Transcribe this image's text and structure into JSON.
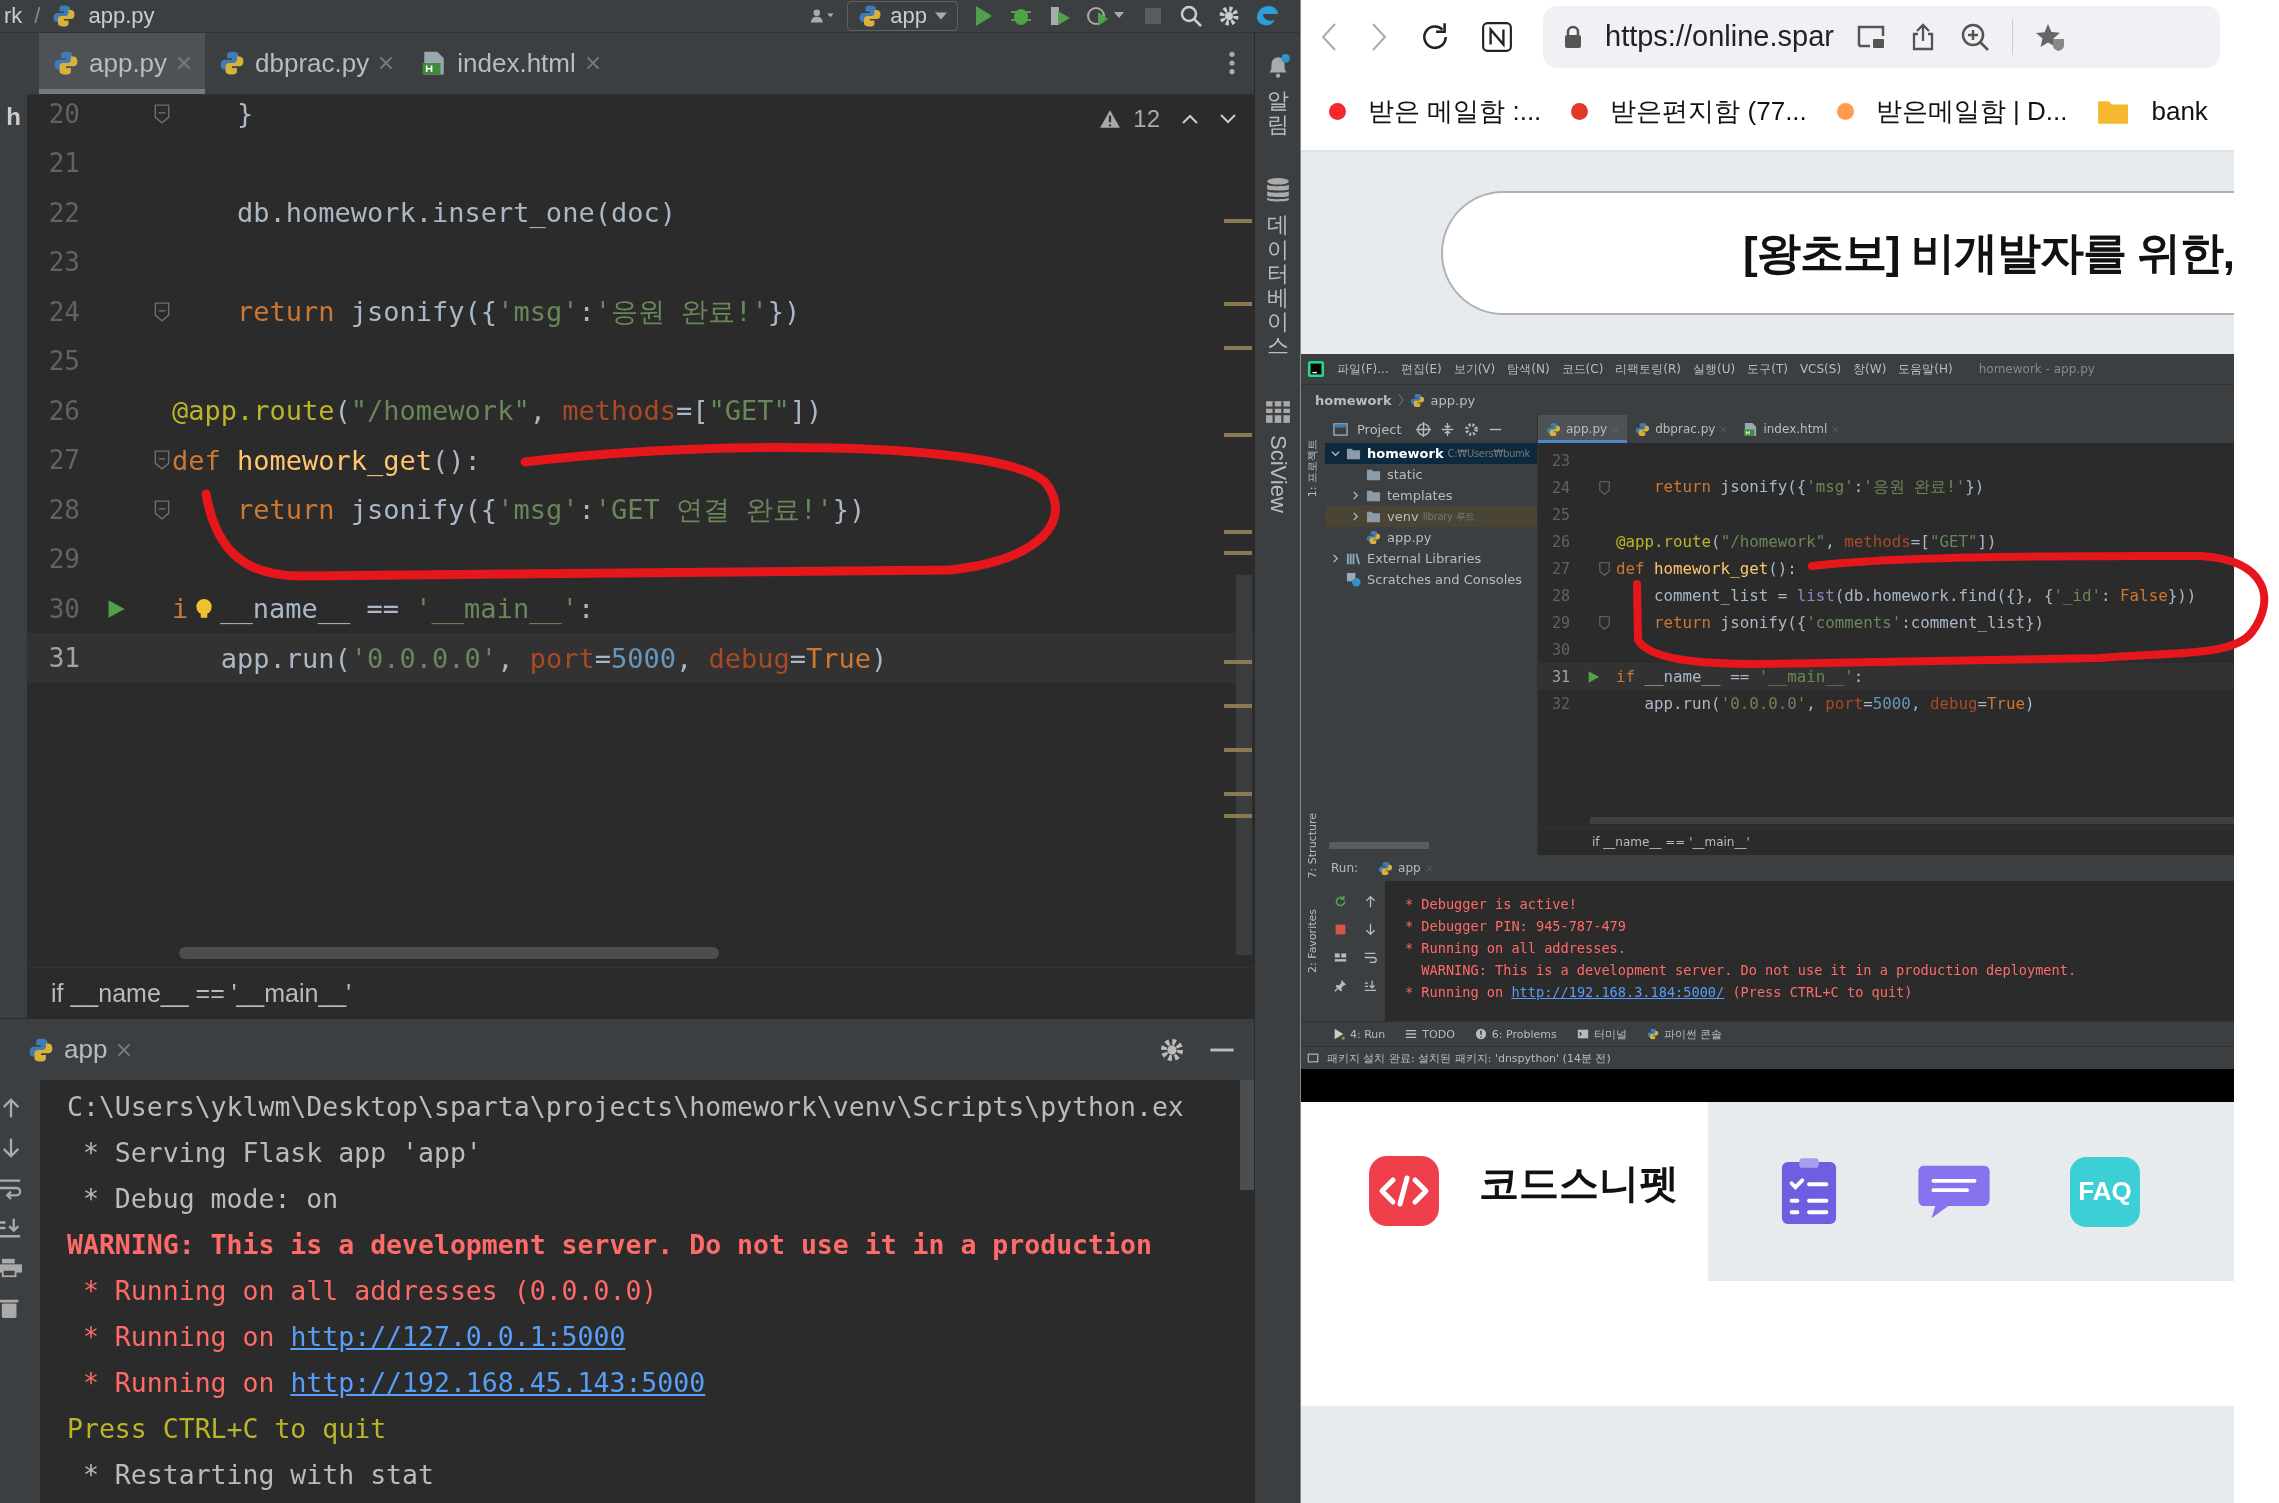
{
  "ide": {
    "toolbar": {
      "path": [
        {
          "kind": "text",
          "text": "rk"
        },
        {
          "kind": "sep",
          "text": "/"
        },
        {
          "kind": "file",
          "text": "app.py"
        }
      ],
      "run_config": "app"
    },
    "tabs": [
      {
        "label": "app.py",
        "kind": "python",
        "selected": true
      },
      {
        "label": "dbprac.py",
        "kind": "python",
        "selected": false
      },
      {
        "label": "index.html",
        "kind": "html",
        "selected": false
      }
    ],
    "left_strip_text": "h",
    "right_strip": [
      {
        "label": "알림",
        "kind": "bell"
      },
      {
        "label": "데이터베이스",
        "kind": "database"
      },
      {
        "label": "SciView",
        "kind": "grid"
      }
    ],
    "inspection": {
      "warnings": "12"
    },
    "code_lines": [
      {
        "number": "20",
        "kind": "fold",
        "current": false,
        "tokens": [
          {
            "kind": "plain",
            "text": "    }"
          }
        ]
      },
      {
        "number": "21",
        "kind": "plain",
        "current": false
      },
      {
        "number": "22",
        "kind": "plain",
        "current": false,
        "tokens": [
          {
            "kind": "plain",
            "text": "    db.homework.insert_one(doc)"
          }
        ]
      },
      {
        "number": "23",
        "kind": "plain",
        "current": false
      },
      {
        "number": "24",
        "kind": "fold",
        "current": false,
        "tokens": [
          {
            "kind": "keyword",
            "text": "    return"
          },
          {
            "kind": "plain",
            "text": " jsonify({"
          },
          {
            "kind": "string",
            "text": "'msg'"
          },
          {
            "kind": "plain",
            "text": ":"
          },
          {
            "kind": "string",
            "text": "'응원 완료!'"
          },
          {
            "kind": "plain",
            "text": "})"
          }
        ]
      },
      {
        "number": "25",
        "kind": "plain",
        "current": false
      },
      {
        "number": "26",
        "kind": "plain",
        "current": false,
        "tokens": [
          {
            "kind": "decorator",
            "text": "@app.route"
          },
          {
            "kind": "plain",
            "text": "("
          },
          {
            "kind": "string",
            "text": "\"/homework\""
          },
          {
            "kind": "plain",
            "text": ", "
          },
          {
            "kind": "param",
            "text": "methods"
          },
          {
            "kind": "plain",
            "text": "=["
          },
          {
            "kind": "string",
            "text": "\"GET\""
          },
          {
            "kind": "plain",
            "text": "])"
          }
        ]
      },
      {
        "number": "27",
        "kind": "fold",
        "current": false,
        "tokens": [
          {
            "kind": "keyword",
            "text": "def "
          },
          {
            "kind": "func",
            "text": "homework_get"
          },
          {
            "kind": "plain",
            "text": "():"
          }
        ]
      },
      {
        "number": "28",
        "kind": "fold",
        "current": false,
        "tokens": [
          {
            "kind": "keyword",
            "text": "    return"
          },
          {
            "kind": "plain",
            "text": " jsonify({"
          },
          {
            "kind": "string",
            "text": "'msg'"
          },
          {
            "kind": "plain",
            "text": ":"
          },
          {
            "kind": "string",
            "text": "'GET 연결 완료!'"
          },
          {
            "kind": "plain",
            "text": "})"
          }
        ]
      },
      {
        "number": "29",
        "kind": "plain",
        "current": false
      },
      {
        "number": "30",
        "kind": "run",
        "current": false,
        "tokens": [
          {
            "kind": "keyword",
            "text": "i"
          },
          {
            "kind": "bulb"
          },
          {
            "kind": "plain",
            "text": "__name__ == "
          },
          {
            "kind": "string",
            "text": "'__main__'"
          },
          {
            "kind": "plain",
            "text": ":"
          }
        ]
      },
      {
        "number": "31",
        "kind": "plain",
        "current": true,
        "tokens": [
          {
            "kind": "plain",
            "text": "   app.run("
          },
          {
            "kind": "string",
            "text": "'0.0.0.0'"
          },
          {
            "kind": "plain",
            "text": ", "
          },
          {
            "kind": "param",
            "text": "port"
          },
          {
            "kind": "plain",
            "text": "="
          },
          {
            "kind": "number",
            "text": "5000"
          },
          {
            "kind": "plain",
            "text": ", "
          },
          {
            "kind": "param",
            "text": "debug"
          },
          {
            "kind": "plain",
            "text": "="
          },
          {
            "kind": "keyword",
            "text": "True"
          },
          {
            "kind": "plain",
            "text": ")"
          }
        ]
      }
    ],
    "breadcrumb": "if __name__ == '__main__'",
    "run_tab": "app",
    "console": [
      {
        "kind": "plain",
        "text": "C:\\Users\\yklwm\\Desktop\\sparta\\projects\\homework\\venv\\Scripts\\python.ex"
      },
      {
        "kind": "plain",
        "text": " * Serving Flask app 'app'"
      },
      {
        "kind": "plain",
        "text": " * Debug mode: on"
      },
      {
        "kind": "warning",
        "text": "WARNING: This is a development server. Do not use it in a production"
      },
      {
        "kind": "error",
        "text": " * Running on all addresses (0.0.0.0)"
      },
      {
        "kind": "link",
        "text": " * Running on ",
        "url": "http://127.0.0.1:5000"
      },
      {
        "kind": "link",
        "text": " * Running on ",
        "url": "http://192.168.45.143:5000"
      },
      {
        "kind": "notice",
        "text": "Press CTRL+C to quit"
      },
      {
        "kind": "plain",
        "text": " * Restarting with stat"
      }
    ]
  },
  "browser": {
    "nav": {
      "back_enabled": false,
      "forward_enabled": false
    },
    "address": "https://online.spar",
    "bookmarks": [
      {
        "label": "받은 메일함 :...",
        "kind": "dot",
        "color": "#f5282a"
      },
      {
        "label": "받은편지함 (77...",
        "kind": "dot",
        "color": "#e0392b"
      },
      {
        "label": "받은메일함 | D...",
        "kind": "dot",
        "color": "#ff9a4f"
      },
      {
        "label": "bank",
        "kind": "folder"
      }
    ],
    "course_title": "[왕초보] 비개발자를 위한,",
    "video": {
      "menu": [
        "파일(F)...",
        "편집(E)",
        "보기(V)",
        "탐색(N)",
        "코드(C)",
        "리팩토링(R)",
        "실행(U)",
        "도구(T)",
        "VCS(S)",
        "창(W)",
        "도움말(H)"
      ],
      "title": "homework - app.py",
      "breadcrumb": [
        "homework",
        "app.py"
      ],
      "side_tabs": [
        {
          "label": "1: 프로젝트",
          "kind": "project"
        },
        {
          "label": "7: Structure",
          "kind": "structure"
        },
        {
          "label": "2: Favorites",
          "kind": "favorites"
        }
      ],
      "project_header": "Project",
      "tree": [
        {
          "label": "homework",
          "path": "C:₩Users₩bumk",
          "kind": "folder",
          "expanded": true,
          "selected": true,
          "excluded": false,
          "children": [
            {
              "label": "static",
              "kind": "folder",
              "selected": false,
              "excluded": false
            },
            {
              "label": "templates",
              "kind": "folder",
              "expanded": false,
              "selected": false,
              "excluded": false
            },
            {
              "label": "venv",
              "note": "library 루트",
              "kind": "folder",
              "expanded": false,
              "selected": false,
              "excluded": true
            },
            {
              "label": "app.py",
              "kind": "python",
              "selected": false,
              "excluded": false
            }
          ]
        },
        {
          "label": "External Libraries",
          "kind": "library",
          "expanded": false,
          "selected": false,
          "excluded": false
        },
        {
          "label": "Scratches and Consoles",
          "kind": "scratch",
          "selected": false,
          "excluded": false
        }
      ],
      "tabs": [
        {
          "label": "app.py",
          "kind": "python",
          "selected": true
        },
        {
          "label": "dbprac.py",
          "kind": "python",
          "selected": false
        },
        {
          "label": "index.html",
          "kind": "html",
          "selected": false
        }
      ],
      "code_lines": [
        {
          "number": "23",
          "kind": "plain",
          "current": false
        },
        {
          "number": "24",
          "kind": "fold",
          "current": false,
          "tokens": [
            {
              "kind": "keyword",
              "text": "    return"
            },
            {
              "kind": "plain",
              "text": " jsonify({"
            },
            {
              "kind": "string",
              "text": "'msg'"
            },
            {
              "kind": "plain",
              "text": ":"
            },
            {
              "kind": "string",
              "text": "'응원 완료!'"
            },
            {
              "kind": "plain",
              "text": "})"
            }
          ]
        },
        {
          "number": "25",
          "kind": "plain",
          "current": false
        },
        {
          "number": "26",
          "kind": "plain",
          "current": false,
          "tokens": [
            {
              "kind": "decorator",
              "text": "@app.route"
            },
            {
              "kind": "plain",
              "text": "("
            },
            {
              "kind": "string",
              "text": "\"/homework\""
            },
            {
              "kind": "plain",
              "text": ", "
            },
            {
              "kind": "param",
              "text": "methods"
            },
            {
              "kind": "plain",
              "text": "=["
            },
            {
              "kind": "string",
              "text": "\"GET\""
            },
            {
              "kind": "plain",
              "text": "])"
            }
          ]
        },
        {
          "number": "27",
          "kind": "fold",
          "current": false,
          "tokens": [
            {
              "kind": "keyword",
              "text": "def "
            },
            {
              "kind": "func",
              "text": "homework_get"
            },
            {
              "kind": "plain",
              "text": "():"
            }
          ]
        },
        {
          "number": "28",
          "kind": "plain",
          "current": false,
          "tokens": [
            {
              "kind": "plain",
              "text": "    comment_list = "
            },
            {
              "kind": "builtin",
              "text": "list"
            },
            {
              "kind": "plain",
              "text": "(db.homework.find({}, {"
            },
            {
              "kind": "string",
              "text": "'_id'"
            },
            {
              "kind": "plain",
              "text": ": "
            },
            {
              "kind": "keyword",
              "text": "False"
            },
            {
              "kind": "plain",
              "text": "}))"
            }
          ]
        },
        {
          "number": "29",
          "kind": "fold",
          "current": false,
          "tokens": [
            {
              "kind": "keyword",
              "text": "    return"
            },
            {
              "kind": "plain",
              "text": " jsonify({"
            },
            {
              "kind": "string",
              "text": "'comments'"
            },
            {
              "kind": "plain",
              "text": ":comment_list})"
            }
          ]
        },
        {
          "number": "30",
          "kind": "plain",
          "current": false
        },
        {
          "number": "31",
          "kind": "run",
          "current": true,
          "tokens": [
            {
              "kind": "keyword",
              "text": "if"
            },
            {
              "kind": "plain",
              "text": " __name__ == "
            },
            {
              "kind": "string",
              "text": "'__main__'"
            },
            {
              "kind": "plain",
              "text": ":"
            }
          ]
        },
        {
          "number": "32",
          "kind": "plain",
          "current": false,
          "tokens": [
            {
              "kind": "plain",
              "text": "   app.run("
            },
            {
              "kind": "string",
              "text": "'0.0.0.0'"
            },
            {
              "kind": "plain",
              "text": ", "
            },
            {
              "kind": "param",
              "text": "port"
            },
            {
              "kind": "plain",
              "text": "="
            },
            {
              "kind": "number",
              "text": "5000"
            },
            {
              "kind": "plain",
              "text": ", "
            },
            {
              "kind": "param",
              "text": "debug"
            },
            {
              "kind": "plain",
              "text": "="
            },
            {
              "kind": "keyword",
              "text": "True"
            },
            {
              "kind": "plain",
              "text": ")"
            }
          ]
        }
      ],
      "code_breadcrumb": "if __name__ == '__main__'",
      "run_label": "Run:",
      "run_tab": "app",
      "console": [
        {
          "kind": "error",
          "text": "* Debugger is active!"
        },
        {
          "kind": "error",
          "text": "* Debugger PIN: 945-787-479"
        },
        {
          "kind": "error",
          "text": "* Running on all addresses."
        },
        {
          "kind": "error",
          "text": "  WARNING: This is a development server. Do not use it in a production deployment."
        },
        {
          "kind": "link",
          "text": "* Running on ",
          "url": "http://192.168.3.184:5000/",
          "suffix": " (Press CTRL+C to quit)"
        }
      ],
      "bottom_tabs": [
        {
          "label": "4: Run",
          "kind": "run"
        },
        {
          "label": "TODO",
          "kind": "todo"
        },
        {
          "label": "6: Problems",
          "kind": "problems"
        },
        {
          "label": "터미널",
          "kind": "terminal"
        },
        {
          "label": "파이썬 콘솔",
          "kind": "python"
        }
      ],
      "status": "패키지 설치 완료: 설치된 패키지: 'dnspython' (14분 전)"
    },
    "tools": {
      "snippet_label": "코드스니펫",
      "faq": "FAQ"
    }
  }
}
